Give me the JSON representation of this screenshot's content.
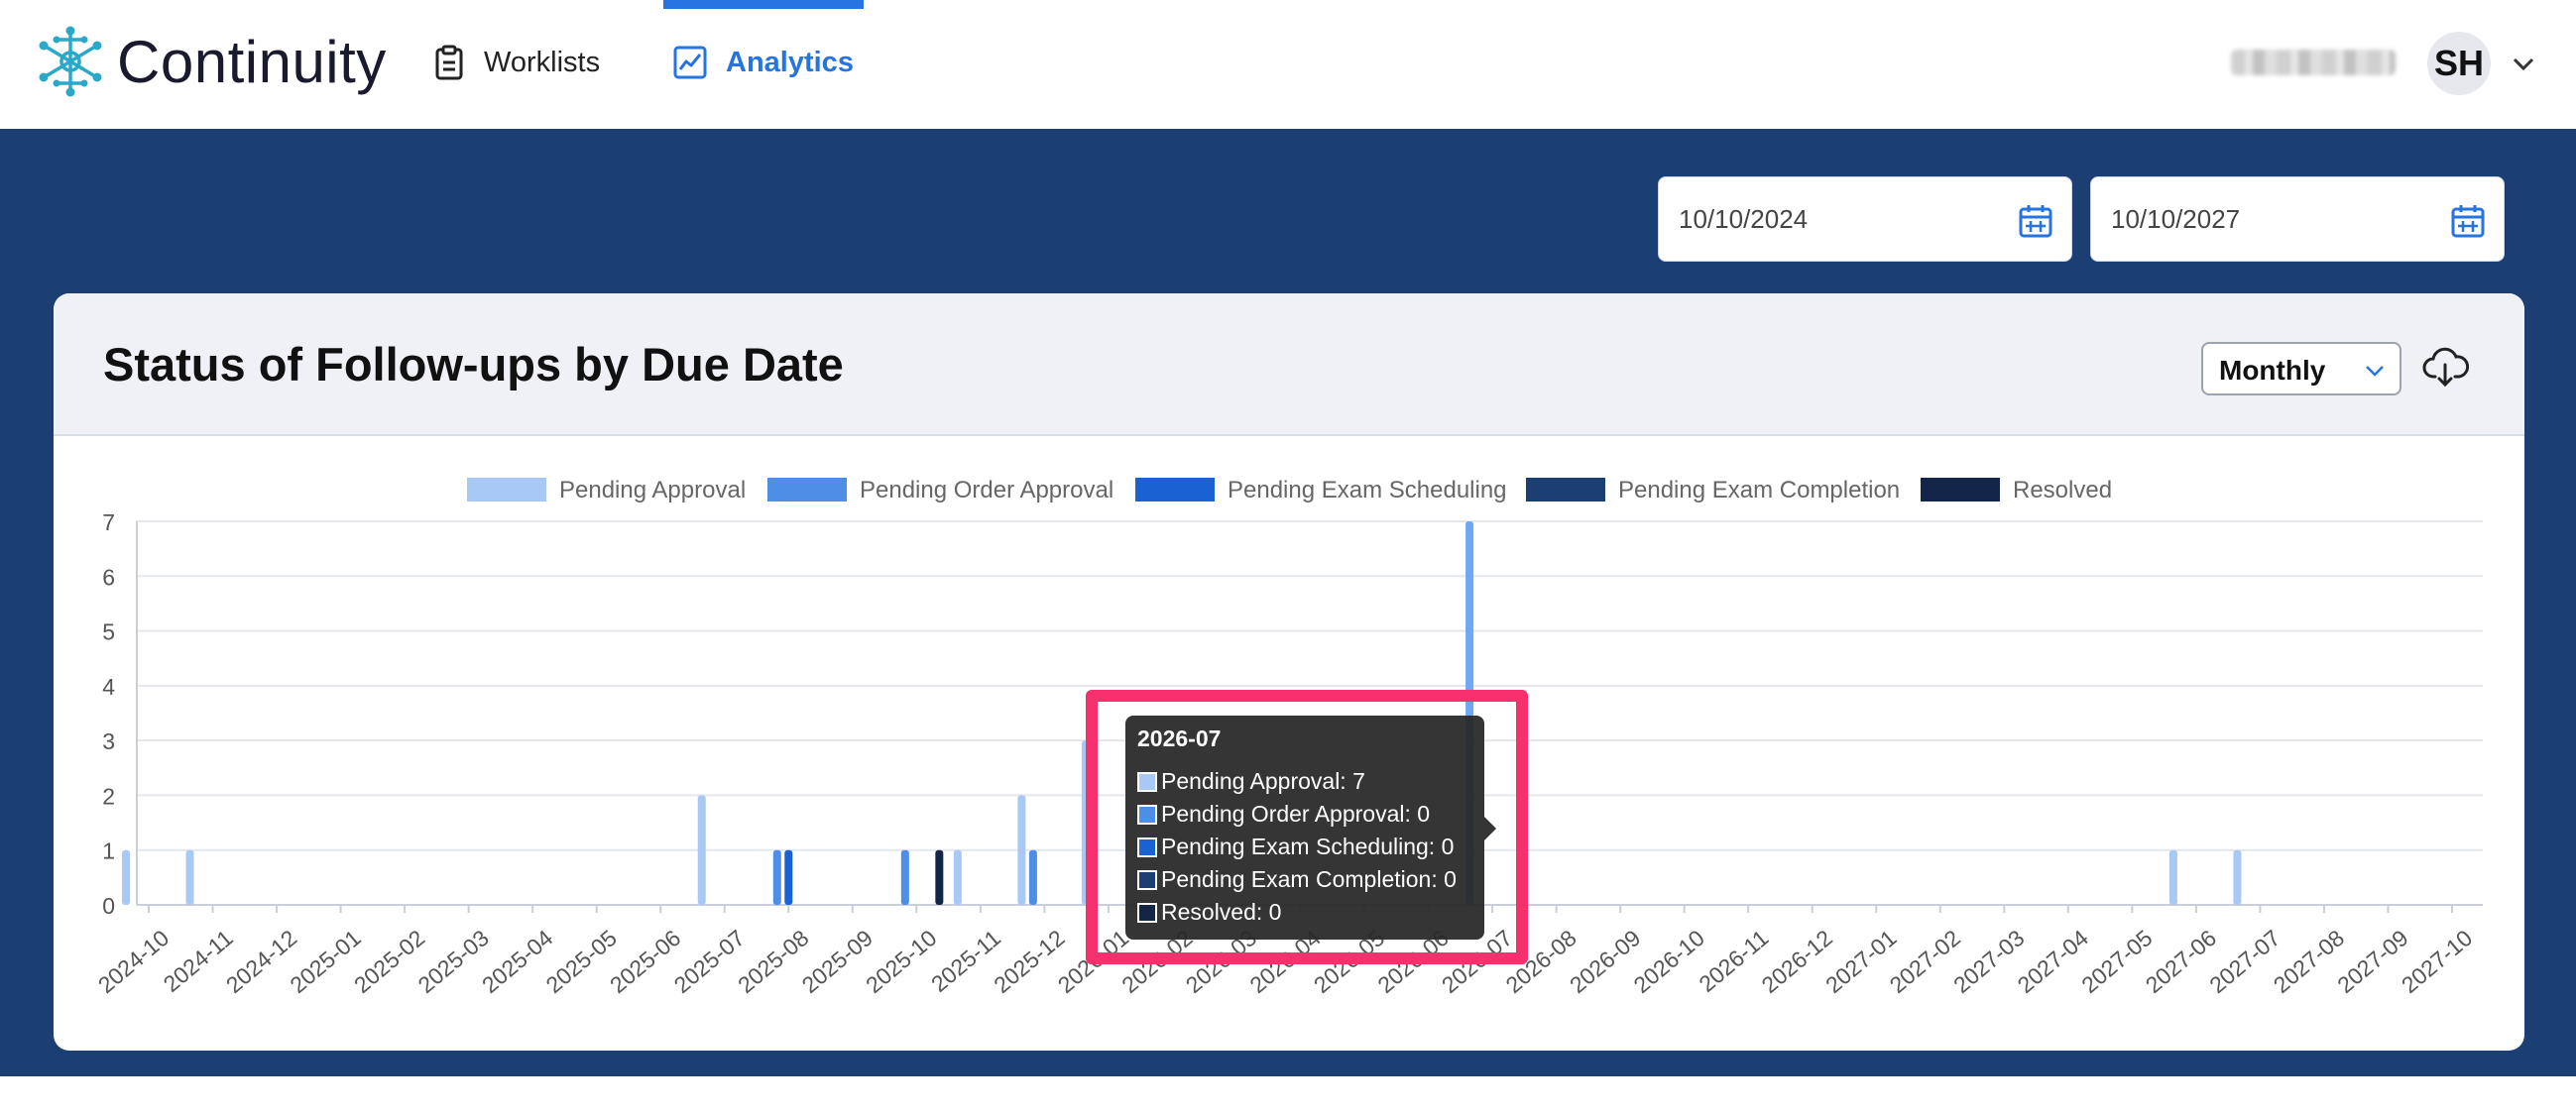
{
  "app": {
    "name": "Continuity"
  },
  "nav": {
    "worklists_label": "Worklists",
    "analytics_label": "Analytics"
  },
  "user": {
    "initials": "SH"
  },
  "filters": {
    "start_date": "10/10/2024",
    "end_date": "10/10/2027"
  },
  "card": {
    "title": "Status of Follow-ups by Due Date",
    "interval": "Monthly"
  },
  "colors": {
    "accent": "#2674e0",
    "background": "#1b3f73",
    "highlight": "#f5306d",
    "pending_approval": "#a8c8f5",
    "pending_order_approval": "#4e8ee6",
    "pending_exam_scheduling": "#1a62d4",
    "pending_exam_completion": "#1b3f73",
    "resolved": "#14254a"
  },
  "icons": {
    "logo": "network-molecule-icon",
    "worklists": "clipboard-icon",
    "analytics": "trend-chart-icon",
    "calendar": "calendar-icon",
    "download": "cloud-download-icon",
    "chevron": "chevron-down-icon"
  },
  "chart_data": {
    "type": "bar",
    "ylim": [
      0,
      7
    ],
    "yticks": [
      "0",
      "1",
      "2",
      "3",
      "4",
      "5",
      "6",
      "7"
    ],
    "legend_position": "top-center",
    "grid": true,
    "categories": [
      "2024-10",
      "2024-11",
      "2024-12",
      "2025-01",
      "2025-02",
      "2025-03",
      "2025-04",
      "2025-05",
      "2025-06",
      "2025-07",
      "2025-08",
      "2025-09",
      "2025-10",
      "2025-11",
      "2025-12",
      "2026-01",
      "2026-02",
      "2026-03",
      "2026-04",
      "2026-05",
      "2026-06",
      "2026-07",
      "2026-08",
      "2026-09",
      "2026-10",
      "2026-11",
      "2026-12",
      "2027-01",
      "2027-02",
      "2027-03",
      "2027-04",
      "2027-05",
      "2027-06",
      "2027-07",
      "2027-08",
      "2027-09",
      "2027-10"
    ],
    "series": [
      {
        "name": "Pending Approval",
        "color": "#a8c8f5",
        "values": [
          1,
          1,
          0,
          0,
          0,
          0,
          0,
          0,
          0,
          2,
          0,
          0,
          0,
          1,
          2,
          3,
          0,
          0,
          0,
          0,
          0,
          7,
          0,
          0,
          0,
          0,
          0,
          0,
          0,
          0,
          0,
          0,
          1,
          1,
          0,
          0,
          0
        ]
      },
      {
        "name": "Pending Order Approval",
        "color": "#4e8ee6",
        "values": [
          0,
          0,
          0,
          0,
          0,
          0,
          0,
          0,
          0,
          0,
          1,
          0,
          1,
          0,
          1,
          0,
          0,
          0,
          0,
          0,
          0,
          0,
          0,
          0,
          0,
          0,
          0,
          0,
          0,
          0,
          0,
          0,
          0,
          0,
          0,
          0,
          0
        ]
      },
      {
        "name": "Pending Exam Scheduling",
        "color": "#1a62d4",
        "values": [
          0,
          0,
          0,
          0,
          0,
          0,
          0,
          0,
          0,
          0,
          1,
          0,
          0,
          0,
          0,
          0,
          0,
          0,
          0,
          0,
          0,
          0,
          0,
          0,
          0,
          0,
          0,
          0,
          0,
          0,
          0,
          0,
          0,
          0,
          0,
          0,
          0
        ]
      },
      {
        "name": "Pending Exam Completion",
        "color": "#1b3f73",
        "values": [
          0,
          0,
          0,
          0,
          0,
          0,
          0,
          0,
          0,
          0,
          0,
          0,
          0,
          0,
          0,
          0,
          0,
          0,
          0,
          0,
          0,
          0,
          0,
          0,
          0,
          0,
          0,
          0,
          0,
          0,
          0,
          0,
          0,
          0,
          0,
          0,
          0
        ]
      },
      {
        "name": "Resolved",
        "color": "#14254a",
        "values": [
          0,
          0,
          0,
          0,
          0,
          0,
          0,
          0,
          0,
          0,
          0,
          0,
          1,
          0,
          0,
          0,
          0,
          0,
          0,
          0,
          0,
          0,
          0,
          0,
          0,
          0,
          0,
          0,
          0,
          0,
          0,
          0,
          0,
          0,
          0,
          0,
          0
        ]
      }
    ]
  },
  "tooltip": {
    "title": "2026-07",
    "rows": [
      {
        "label": "Pending Approval: 7",
        "color": "#a8c8f5"
      },
      {
        "label": "Pending Order Approval: 0",
        "color": "#4e8ee6"
      },
      {
        "label": "Pending Exam Scheduling: 0",
        "color": "#1a62d4"
      },
      {
        "label": "Pending Exam Completion: 0",
        "color": "#1b3f73"
      },
      {
        "label": "Resolved: 0",
        "color": "#14254a"
      }
    ]
  }
}
